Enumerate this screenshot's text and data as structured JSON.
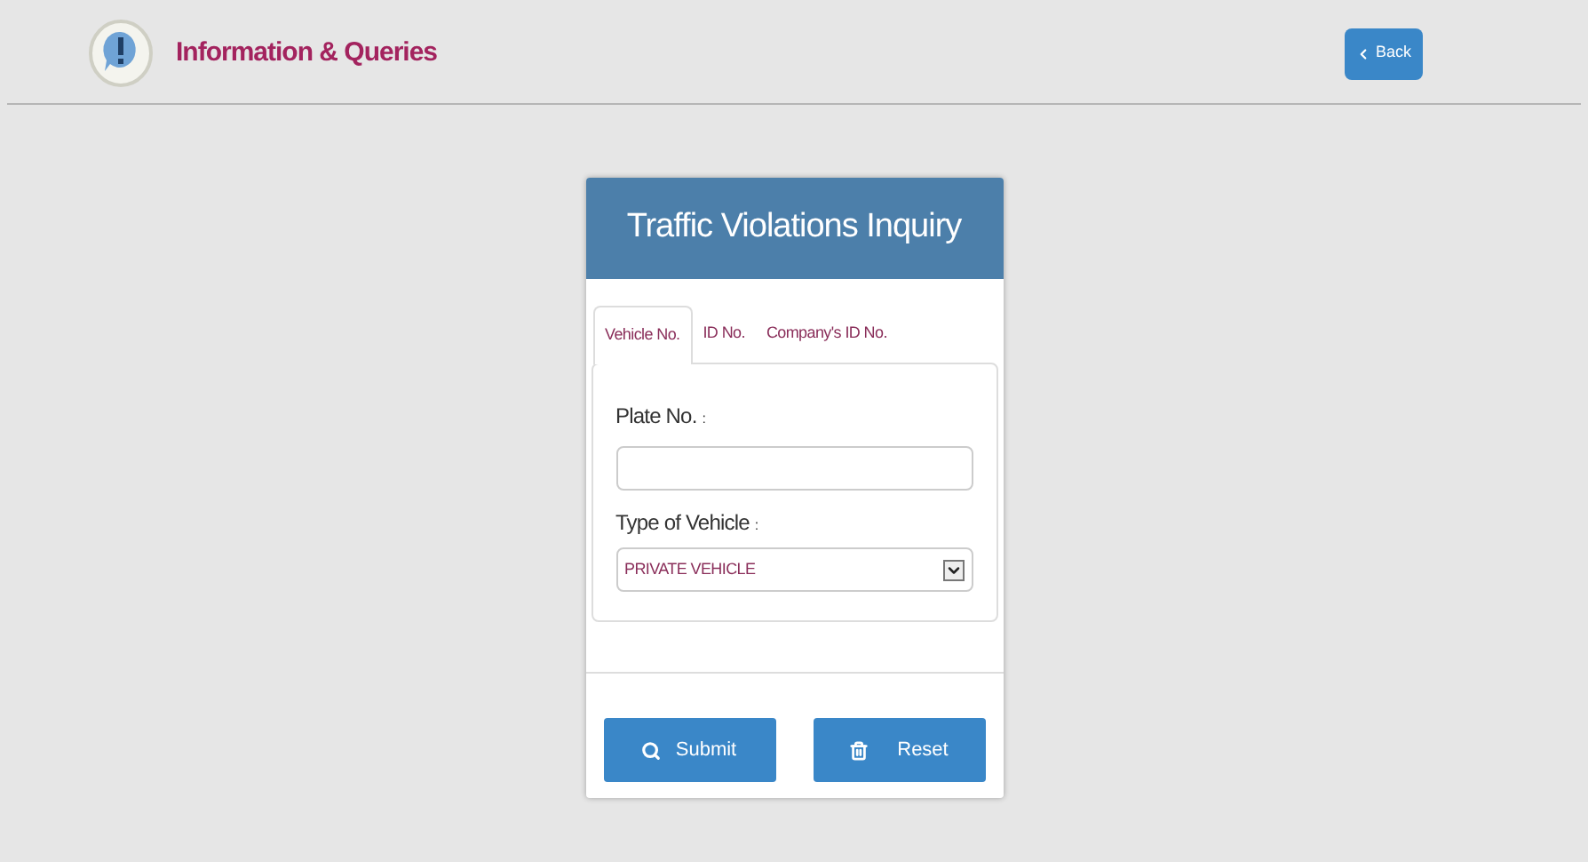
{
  "header": {
    "title": "Information & Queries",
    "back_button": "Back"
  },
  "card": {
    "title": "Traffic Violations Inquiry",
    "tabs": [
      {
        "label": "Vehicle No.",
        "selected": true
      },
      {
        "label": "ID No.",
        "selected": false
      },
      {
        "label": "Company's ID No.",
        "selected": false
      }
    ],
    "plate_label": "Plate No.",
    "plate_colon": ":",
    "type_label": "Type of Vehicle",
    "type_colon": ":",
    "type_value": "PRIVATE VEHICLE",
    "submit": "Submit",
    "reset": "Reset"
  }
}
